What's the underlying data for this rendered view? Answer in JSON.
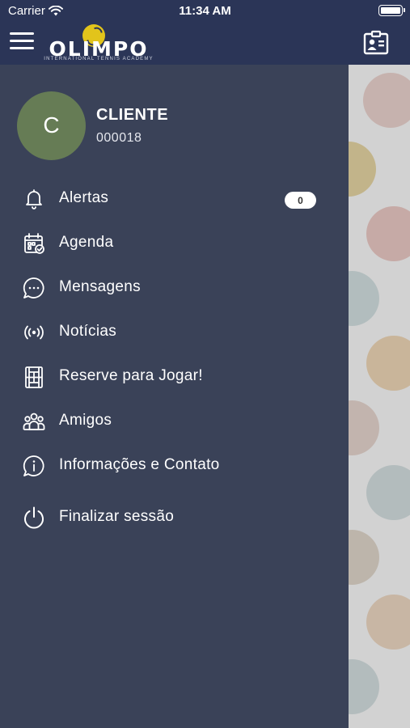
{
  "status_bar": {
    "carrier": "Carrier",
    "time": "11:34 AM"
  },
  "header": {
    "logo_text": "OLIMPO",
    "logo_subtitle": "INTERNATIONAL TENNIS ACADEMY"
  },
  "profile": {
    "avatar_initial": "C",
    "name": "CLIENTE",
    "code": "000018"
  },
  "menu": {
    "items": [
      {
        "label": "Alertas",
        "icon": "bell-icon",
        "badge": "0"
      },
      {
        "label": "Agenda",
        "icon": "calendar-icon"
      },
      {
        "label": "Mensagens",
        "icon": "chat-bubble-icon"
      },
      {
        "label": "Notícias",
        "icon": "broadcast-icon"
      },
      {
        "label": "Reserve para Jogar!",
        "icon": "court-icon"
      },
      {
        "label": "Amigos",
        "icon": "friends-icon"
      },
      {
        "label": "Informações e Contato",
        "icon": "info-bubble-icon"
      },
      {
        "label": "Finalizar sessão",
        "icon": "power-icon"
      }
    ]
  },
  "colors": {
    "header_bg": "#2b3557",
    "drawer_bg": "#3a4258",
    "avatar_bg": "#667c55",
    "logo_ball": "#e2c41b"
  }
}
